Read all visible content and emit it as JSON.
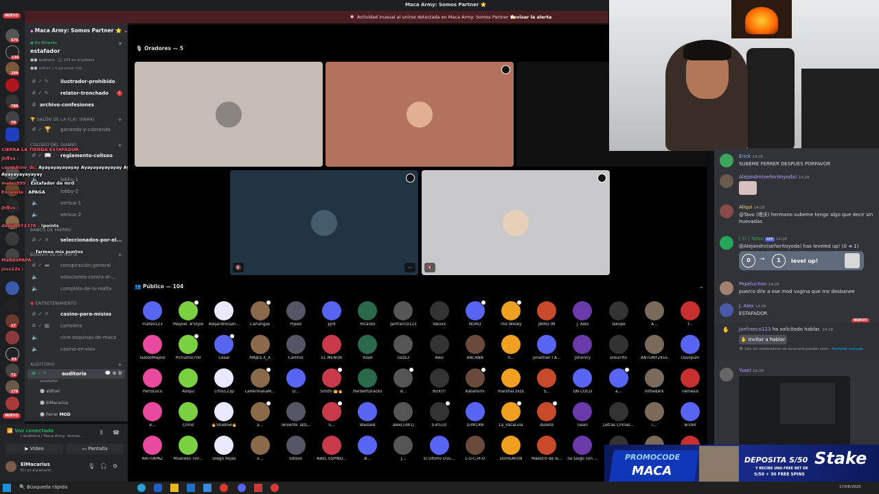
{
  "top": {
    "title": "Maca Army: Somos Partner ⭐"
  },
  "alert": {
    "text": "Actividad inusual al unirse detectada en Maca Army: Somos Partner ⭐",
    "action": "Revisar la alerta"
  },
  "rail": {
    "nuevo": "NUEVO",
    "badges": [
      "570",
      "136",
      "298",
      "786",
      "70",
      "17",
      "83",
      "72",
      "278"
    ]
  },
  "server": {
    "name": "Maca Army: Somos Partner ⭐",
    "live_label": "En Directo",
    "live_channel": "estafador",
    "live_meta": "auditoria · 🎧 104 en el público",
    "live_meta2": "aldhair y 4 personas más"
  },
  "channels": [
    {
      "name": "ilustrador-prohibido",
      "bright": true
    },
    {
      "name": "relator-tronchado",
      "bright": true,
      "badge": "1"
    },
    {
      "name": "archivo-confesiones",
      "bright": true
    },
    {
      "name": "ganando-y-cobrando",
      "bright": false
    },
    {
      "name": "reglamento-coliseo",
      "bright": true
    },
    {
      "name": "lobby-1",
      "bright": false
    },
    {
      "name": "lobby-2",
      "bright": false
    },
    {
      "name": "versus-1",
      "bright": false
    },
    {
      "name": "versus-2",
      "bright": false
    },
    {
      "name": "seleccionados-por-el...",
      "bright": true
    },
    {
      "name": "conspiración-general",
      "bright": false
    },
    {
      "name": "votaciones-contra-el-...",
      "bright": false
    },
    {
      "name": "complots-de-la-mafia",
      "bright": false
    },
    {
      "name": "casino-para-misios",
      "bright": true
    },
    {
      "name": "cartelera",
      "bright": false
    },
    {
      "name": "cine-esquinas-de-maca",
      "bright": false
    },
    {
      "name": "casino-en-vivo",
      "bright": false
    },
    {
      "name": "auditoria",
      "bright": true
    }
  ],
  "categories": [
    "SALÓN DE LA FLA? (FAMA)",
    "COLISEO DEL GUANO",
    "BANCO DE HIERRO",
    "BÚNKER DE LA MAFIA",
    "ENTRETENIMIENTO",
    "AUDITORIO"
  ],
  "auditoria_sub": "estafador",
  "voice_users": [
    "aldhair",
    "ElMacarius",
    "Ferrer"
  ],
  "voice_user_tag": "MOD",
  "overlay_chat": [
    {
      "user": "CIERRA LA TIENDA ESTAFADOR",
      "msg": ""
    },
    {
      "user": "jhffvx :",
      "msg": ""
    },
    {
      "user": "capuchino_dc:",
      "msg": "Ayayayayayayay Ayayayayayayay Ayayayayayayay"
    },
    {
      "user": "Ayayayayayayay",
      "msg": ""
    },
    {
      "user": "mater899 :",
      "msg": "Estafador de mrd"
    },
    {
      "user": "Excencia :",
      "msg": "APAGA"
    },
    {
      "user": "jhffvx :",
      "msg": ""
    },
    {
      "user": "david_072378 :",
      "msg": "!points"
    },
    {
      "user": "",
      "msg": "farmeo mis puntos"
    },
    {
      "user": "MaRSoPAPA :",
      "msg": ""
    },
    {
      "user": "joss22s :",
      "msg": ""
    }
  ],
  "user_panel": {
    "status": "Voz conectada",
    "server": "/ auditoria / Maca Army: Somos...",
    "video": "Vídeo",
    "screen": "Pantalla",
    "username": "ElMacarius",
    "substatus": "En un escenario"
  },
  "stage": {
    "speakers_label": "Oradores — 5",
    "audience_label": "Público — 104"
  },
  "audience": [
    "mateo123",
    "Maykel. B'Style",
    "Alejandro(señ...",
    "Carlangas",
    "Pijees",
    "pjr8",
    "Ricardo",
    "Janfranco123",
    "Valuxx",
    "NORO",
    "The Wisley",
    "JAIRO IM",
    "J. Alex",
    "Takope",
    "A...",
    "f...",
    "TaatooMajoor",
    "Pichulino700",
    "Cesar",
    "MAJES X_X",
    "Carlitos",
    "EL MENOR",
    "Yusel",
    "luisS3",
    "Aiko",
    "ARCANN",
    "h...",
    "Jonathan I A...",
    "Johonny",
    "elburrito",
    "ANTONY2455",
    "Ossopum",
    "PerroLoco",
    "Alliqui",
    "crhis123p",
    "LaHermanaM...",
    "D...",
    "Smith 👑🔥",
    "HerbertDracks",
    "d...",
    "Rick!!!",
    "Katahomi",
    "marshal zxzx",
    "S...",
    "UN COCO",
    "a...",
    "Inthedark",
    "nemesis",
    "e...",
    "Chino",
    "🔥Shadow🔥",
    "a...",
    "Teniente Tats...",
    "S...",
    "Blessed",
    "alex(1441)",
    "S3rG10",
    "D3M14N",
    "La_VacaLola",
    "dukete",
    "Gean",
    "Letras Chinas...",
    "i...",
    "erv94",
    "RATITAPAZ",
    "Milaneso Tim...",
    "Diego Rojas",
    "x...",
    "Edison",
    "ABEL ESPINO...",
    "B...",
    "J...",
    "El Ultimo Ovu...",
    "L-U-C-H-O",
    "DomEAhnN",
    "Maestro de lo...",
    "no salgo con ...",
    "",
    "",
    ""
  ],
  "chat": [
    {
      "user": "Erick",
      "time": "14:28",
      "text": "SUBEME FERRER DESPUES PORFAVOR",
      "color": "#7ac1ff"
    },
    {
      "user": "Alejandro(señoritoyoda)",
      "time": "14:28",
      "text": "",
      "color": "#b9a3ff"
    },
    {
      "user": "Allqui",
      "time": "14:28",
      "text": "@Tavo (塔沃) hermano subeme tengo algo que decir sin huevadas",
      "color": "#ffd27a"
    },
    {
      "user": "[ t! ] Tatsu",
      "time": "14:28",
      "text": "@Alejandro(señoritoyoda) has leveled up! (0 ➜ 1)",
      "color": "#3ba55c",
      "tag": "APP"
    },
    {
      "user": "Pepeluchon",
      "time": "14:28",
      "text": "puerco dile a ese mod vagina que me desbanee",
      "color": "#b9a3ff"
    },
    {
      "user": "J. Alex",
      "time": "14:28",
      "text": "ESTAFADOR",
      "color": "#b9a3ff"
    },
    {
      "user": "Janfranco123",
      "time": "14:28",
      "text": "ha solicitado hablar.",
      "color": "#b9a3ff"
    },
    {
      "user": "Yusel",
      "time": "14:28",
      "text": "",
      "color": "#b9a3ff"
    }
  ],
  "levelup": {
    "from": "0",
    "to": "1",
    "label": "level up!"
  },
  "invite_label": "Invitar a hablar",
  "invite_note": "Solo los moderadores de escenario pueden verlo ·",
  "invite_reject": "Rechazar mensaje",
  "chat_nuevo": "NUEVO",
  "ad": {
    "promo": "PROMOCODE",
    "code": "MACA",
    "deposit": "DEPOSITA S/50",
    "sub": "Y RECIBE UNA FREE BET DE",
    "sub2": "S/50 + 30 FREE SPINS",
    "brand": "Stake"
  },
  "taskbar": {
    "search": "Búsqueda rápida",
    "date": "17/08/2025"
  }
}
